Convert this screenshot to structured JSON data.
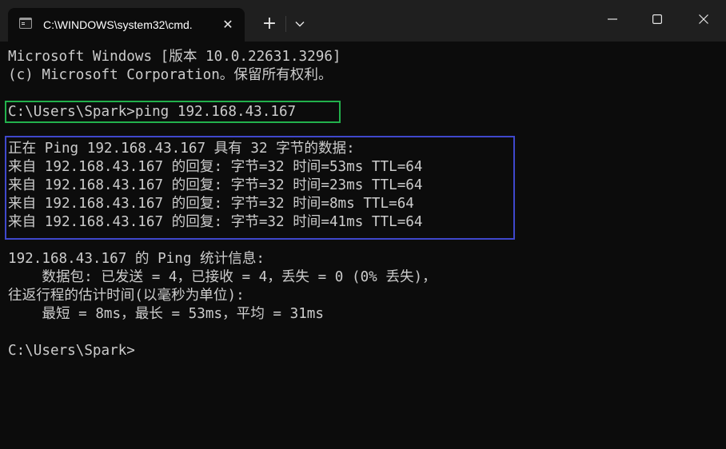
{
  "window": {
    "tab_title": "C:\\WINDOWS\\system32\\cmd.",
    "tab_close_glyph": "✕",
    "new_tab_glyph": "+"
  },
  "console": {
    "lines": [
      "Microsoft Windows [版本 10.0.22631.3296]",
      "(c) Microsoft Corporation。保留所有权利。",
      "",
      "C:\\Users\\Spark>ping 192.168.43.167",
      "",
      "正在 Ping 192.168.43.167 具有 32 字节的数据:",
      "来自 192.168.43.167 的回复: 字节=32 时间=53ms TTL=64",
      "来自 192.168.43.167 的回复: 字节=32 时间=23ms TTL=64",
      "来自 192.168.43.167 的回复: 字节=32 时间=8ms TTL=64",
      "来自 192.168.43.167 的回复: 字节=32 时间=41ms TTL=64",
      "",
      "192.168.43.167 的 Ping 统计信息:",
      "    数据包: 已发送 = 4，已接收 = 4，丢失 = 0 (0% 丢失)，",
      "往返行程的估计时间(以毫秒为单位):",
      "    最短 = 8ms，最长 = 53ms，平均 = 31ms",
      "",
      "C:\\Users\\Spark>"
    ]
  },
  "colors": {
    "background": "#0c0c0c",
    "titlebar": "#1f1f1f",
    "text": "#cccccc",
    "highlight_green": "#22b14c",
    "highlight_blue": "#3f48cc"
  },
  "icons": {
    "tab": "terminal-icon",
    "close_tab": "close-icon",
    "new_tab": "plus-icon",
    "dropdown": "chevron-down-icon",
    "minimize": "minimize-icon",
    "maximize": "maximize-icon",
    "close_window": "close-icon"
  }
}
